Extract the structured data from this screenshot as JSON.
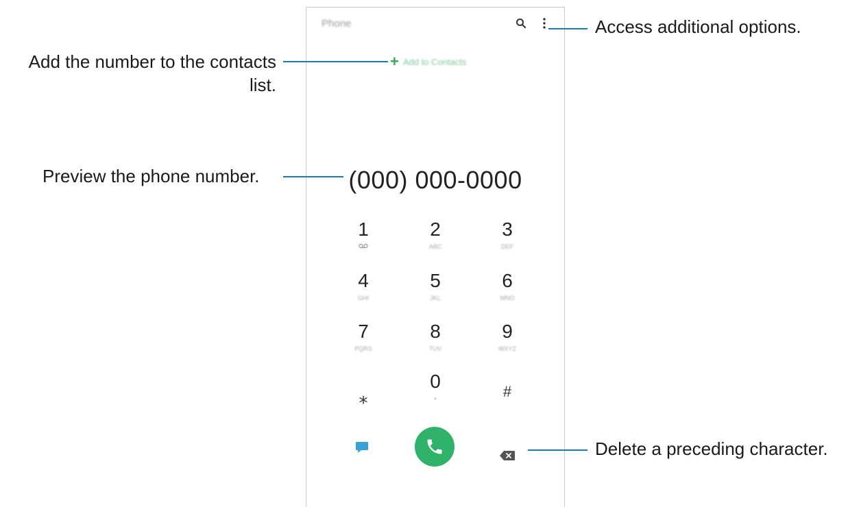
{
  "app": {
    "title": "Phone",
    "search_icon": "search-icon",
    "more_icon": "more-options-icon",
    "add_to_contacts_label": "Add to Contacts",
    "number_display": "(000) 000-0000"
  },
  "keypad": {
    "keys": [
      {
        "digit": "1",
        "sub": "voicemail-icon"
      },
      {
        "digit": "2",
        "sub": "ABC"
      },
      {
        "digit": "3",
        "sub": "DEF"
      },
      {
        "digit": "4",
        "sub": "GHI"
      },
      {
        "digit": "5",
        "sub": "JKL"
      },
      {
        "digit": "6",
        "sub": "MNO"
      },
      {
        "digit": "7",
        "sub": "PQRS"
      },
      {
        "digit": "8",
        "sub": "TUV"
      },
      {
        "digit": "9",
        "sub": "WXYZ"
      },
      {
        "digit": "⁎",
        "sub": ""
      },
      {
        "digit": "0",
        "sub": "+"
      },
      {
        "digit": "#",
        "sub": ""
      }
    ]
  },
  "bottom_bar": {
    "message_icon": "message-icon",
    "call_icon": "phone-icon",
    "backspace_icon": "backspace-icon",
    "colors": {
      "call_button": "#2fb36a",
      "message_icon": "#3aa0d8",
      "accent": "#3aa757"
    }
  },
  "callouts": {
    "options": "Access additional options.",
    "add_contact_line1": "Add the number to the contacts",
    "add_contact_line2": "list.",
    "preview": "Preview the phone number.",
    "delete": "Delete a preceding character.",
    "line_color": "#1a7ab8"
  }
}
